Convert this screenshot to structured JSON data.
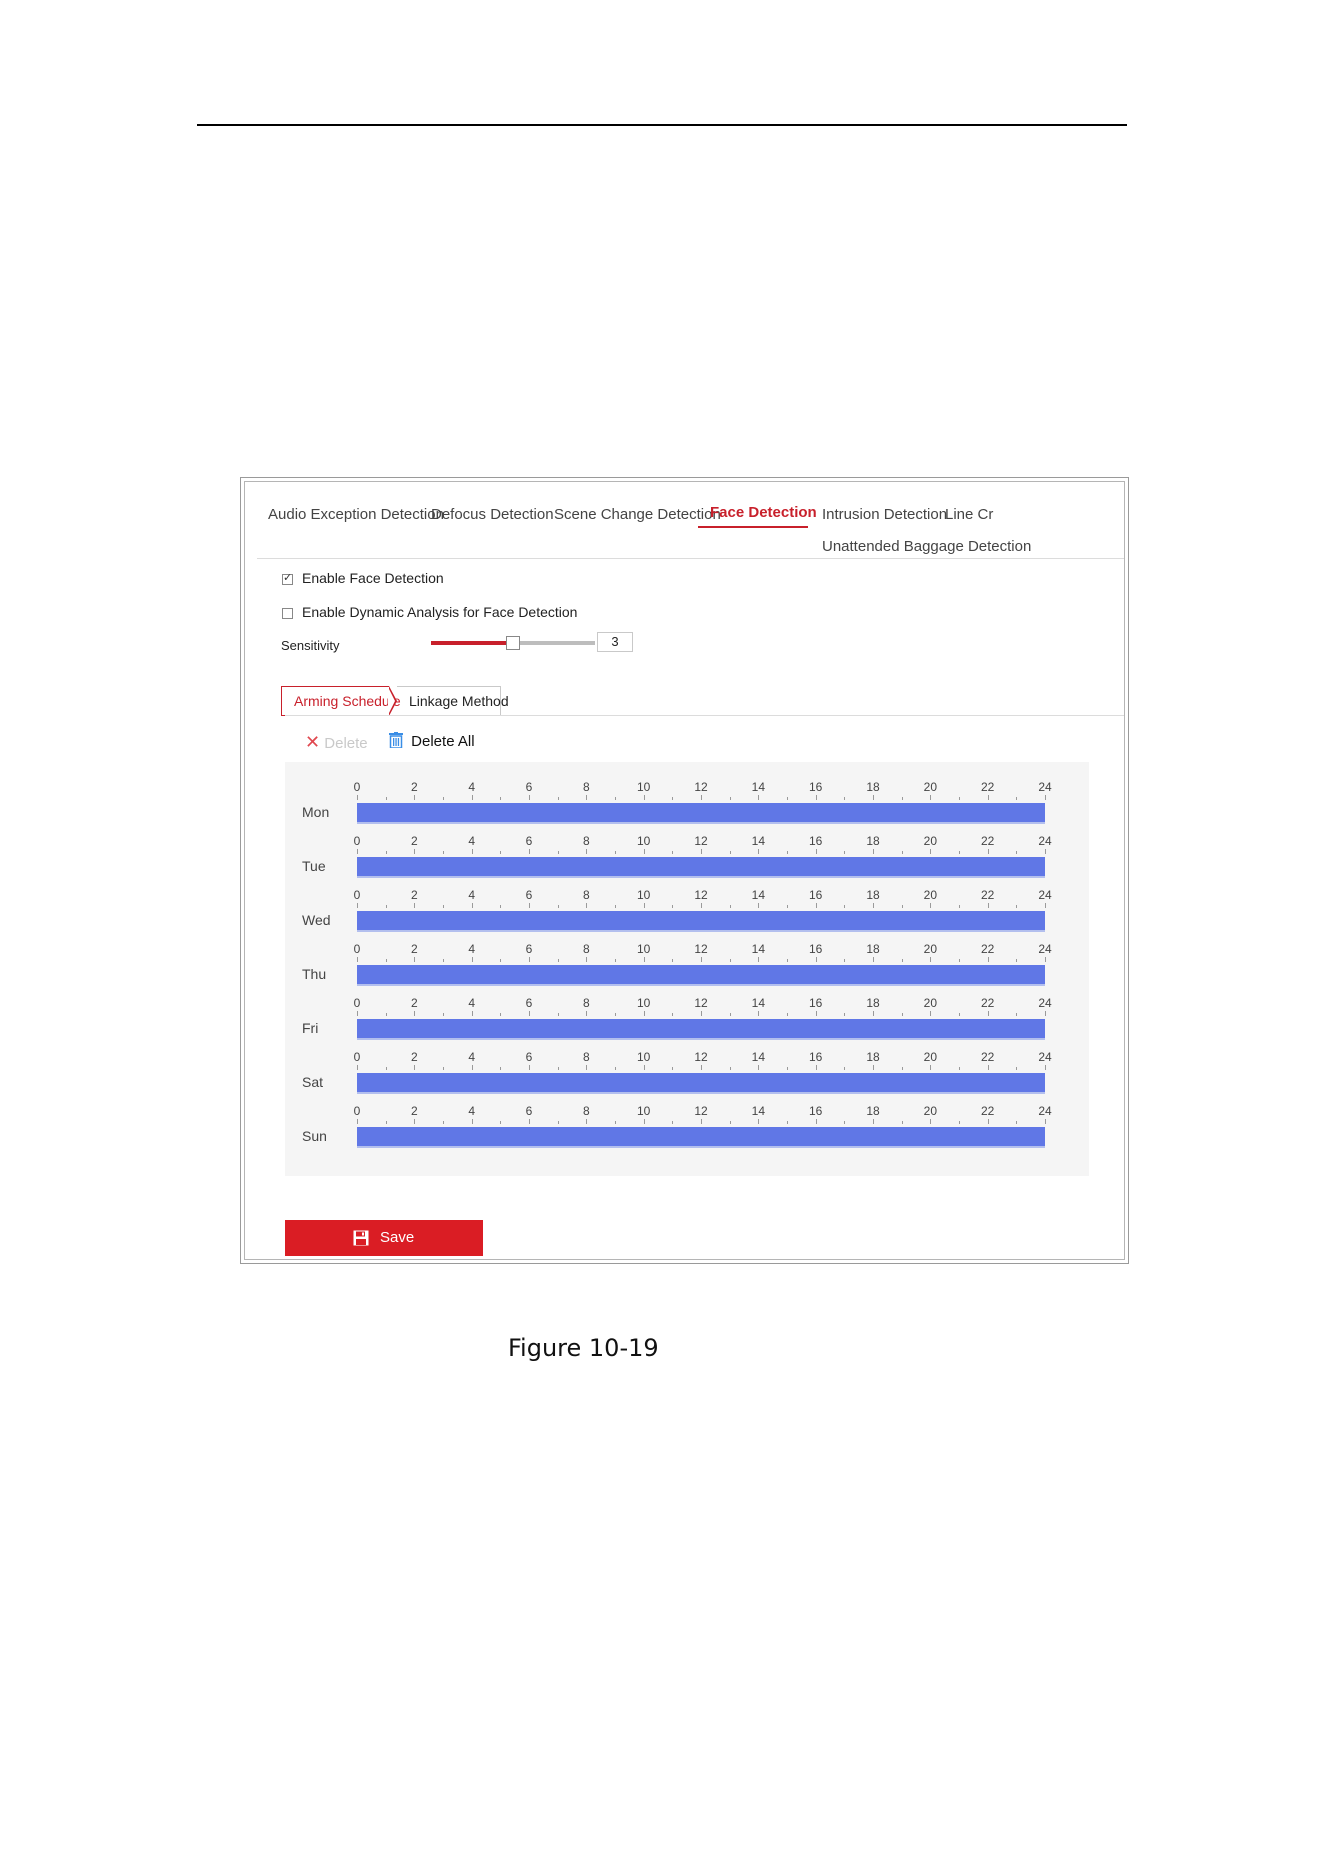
{
  "tabs": [
    {
      "label": "Audio Exception Detection",
      "active": false
    },
    {
      "label": "Defocus Detection",
      "active": false
    },
    {
      "label": "Scene Change Detection",
      "active": false
    },
    {
      "label": "Face Detection",
      "active": true
    },
    {
      "label": "Intrusion Detection",
      "active": false
    },
    {
      "label": "Line Cr",
      "active": false
    },
    {
      "label": "Unattended Baggage Detection",
      "active": false
    }
  ],
  "options": {
    "enable_face_detection": {
      "label": "Enable Face Detection",
      "checked": true
    },
    "enable_dynamic_analysis": {
      "label": "Enable Dynamic Analysis for Face Detection",
      "checked": false
    }
  },
  "sensitivity": {
    "label": "Sensitivity",
    "value": "3",
    "fraction": 0.5
  },
  "subtabs": {
    "arming": "Arming Schedule",
    "linkage": "Linkage Method"
  },
  "toolbar": {
    "delete_label": "Delete",
    "delete_all_label": "Delete All"
  },
  "schedule": {
    "hour_ticks": [
      "0",
      "2",
      "4",
      "6",
      "8",
      "10",
      "12",
      "14",
      "16",
      "18",
      "20",
      "22",
      "24"
    ],
    "days": [
      {
        "label": "Mon",
        "start": 0,
        "end": 24
      },
      {
        "label": "Tue",
        "start": 0,
        "end": 24
      },
      {
        "label": "Wed",
        "start": 0,
        "end": 24
      },
      {
        "label": "Thu",
        "start": 0,
        "end": 24
      },
      {
        "label": "Fri",
        "start": 0,
        "end": 24
      },
      {
        "label": "Sat",
        "start": 0,
        "end": 24
      },
      {
        "label": "Sun",
        "start": 0,
        "end": 24
      }
    ]
  },
  "save_label": "Save",
  "caption": "Figure 10-19",
  "colors": {
    "accent": "#c8202b",
    "schedule_bar": "#6077e6",
    "save_button": "#da1d24",
    "delete_all_icon": "#3a8ee6"
  }
}
